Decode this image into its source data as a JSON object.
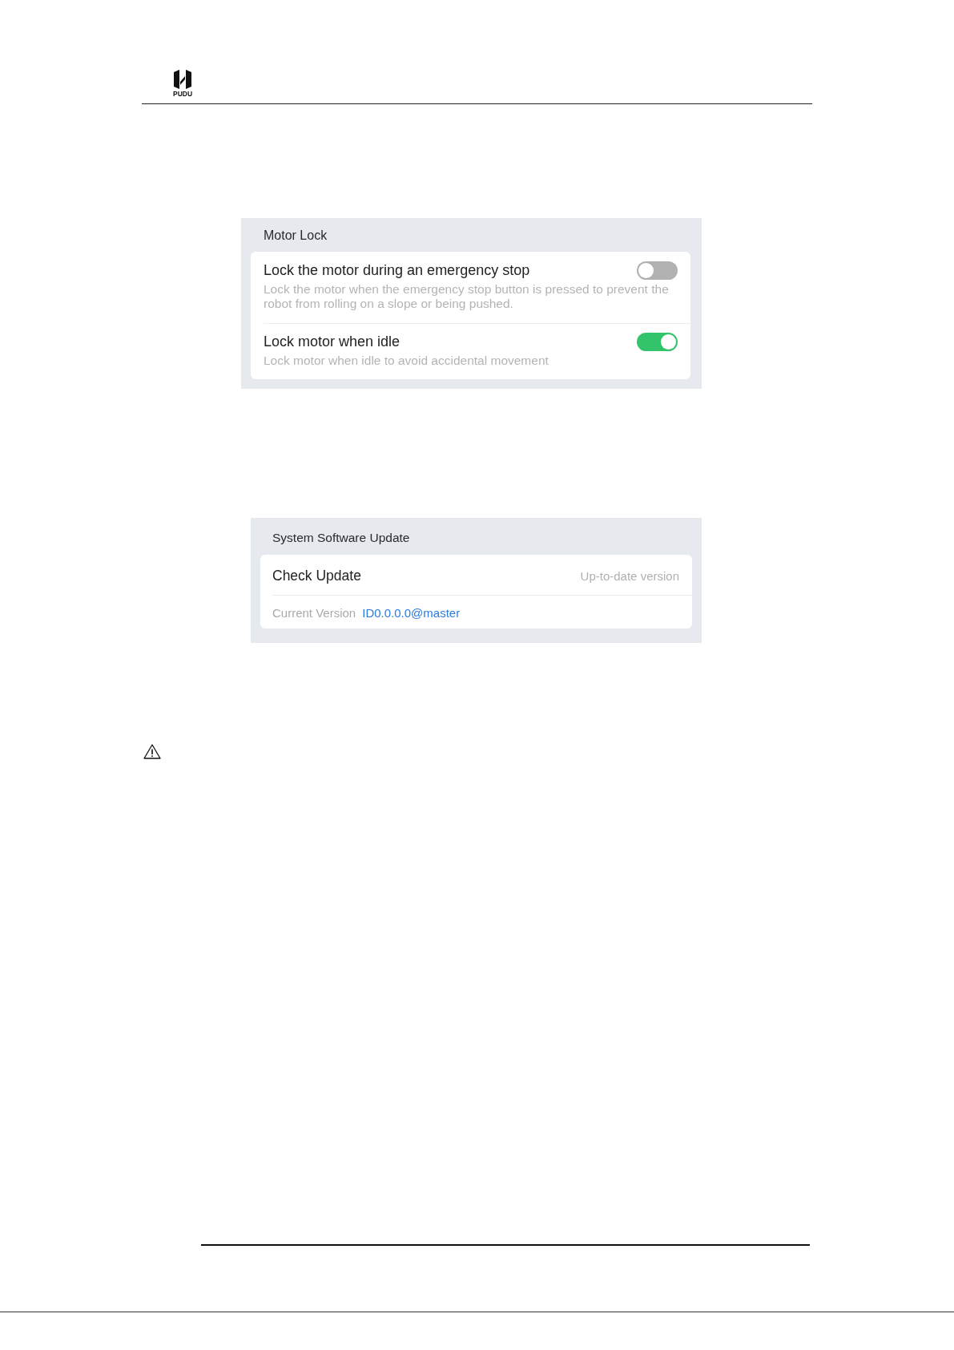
{
  "header": {
    "logo_text": "PUDU"
  },
  "panels": [
    {
      "kind": "settings",
      "title": "Motor Lock",
      "rows": [
        {
          "kind": "toggle",
          "title": "Lock the motor during an emergency stop",
          "description": "Lock the motor when the emergency stop button is pressed to prevent the robot from rolling on a slope or being pushed.",
          "on": false
        },
        {
          "kind": "toggle",
          "title": "Lock motor when idle",
          "description": "Lock motor when idle to avoid accidental movement",
          "on": true
        }
      ]
    },
    {
      "kind": "update",
      "title": "System Software Update",
      "rows": [
        {
          "kind": "status",
          "label": "Check Update",
          "value": "Up-to-date version"
        },
        {
          "kind": "version",
          "label": "Current Version",
          "value": "ID0.0.0.0@master"
        }
      ]
    }
  ]
}
